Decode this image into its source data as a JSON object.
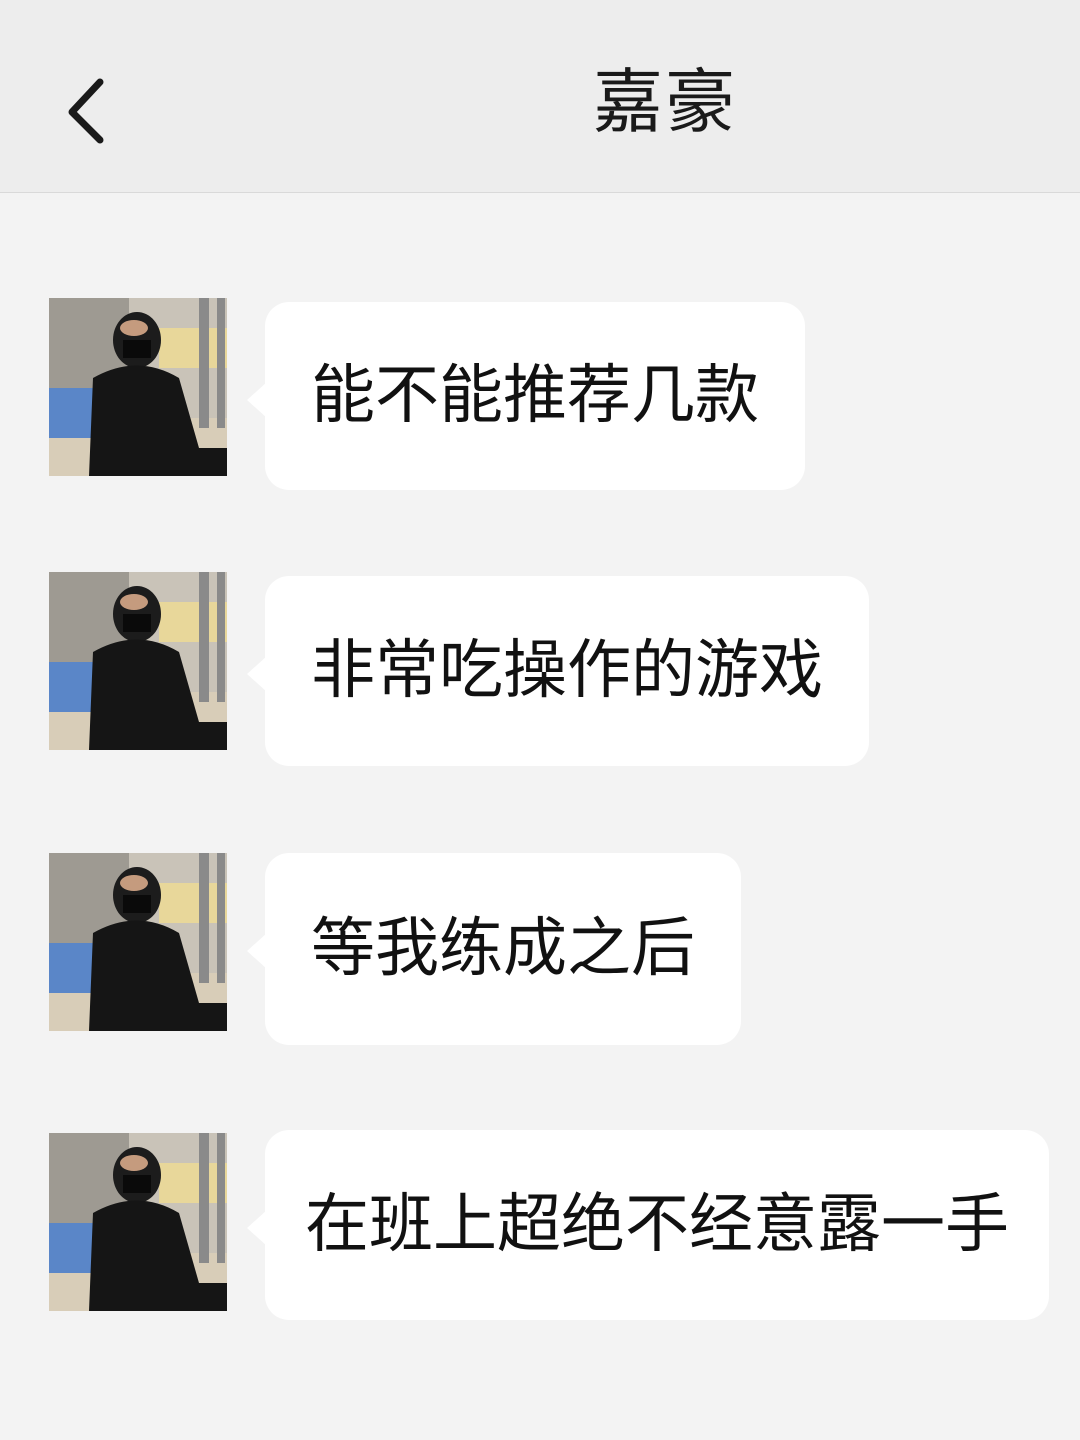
{
  "header": {
    "title": "嘉豪",
    "back_icon": "chevron-left-icon"
  },
  "messages": [
    {
      "text": "能不能推荐几款",
      "avatar_icon": "contact-avatar-photo"
    },
    {
      "text": "非常吃操作的游戏",
      "avatar_icon": "contact-avatar-photo"
    },
    {
      "text": "等我练成之后",
      "avatar_icon": "contact-avatar-photo"
    },
    {
      "text": "在班上超绝不经意露一手",
      "avatar_icon": "contact-avatar-photo"
    }
  ]
}
